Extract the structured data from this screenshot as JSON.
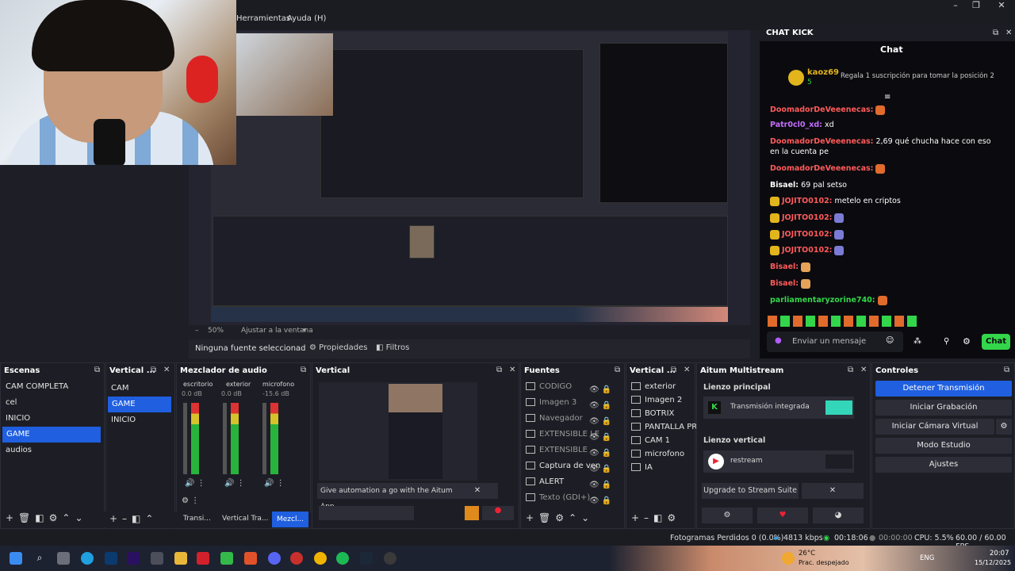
{
  "menu": {
    "tools": "Herramientas",
    "help": "Ayuda (H)"
  },
  "preview": {
    "zoom": "50%",
    "fit": "Ajustar a la ventana"
  },
  "props": {
    "no_source": "Ninguna fuente seleccionad",
    "properties": "Propiedades",
    "filters": "Filtros"
  },
  "chat": {
    "window_title": "CHAT KICK",
    "tab": "Chat",
    "pinned_user": "kaoz69",
    "pinned_count": "5",
    "pinned_text": "Regala 1 suscripción para tomar la posición 2",
    "messages": [
      {
        "user": "DoomadorDeVeeenecas:",
        "text": "",
        "color": "#ff5a5a"
      },
      {
        "user": "Patr0cl0_xd:",
        "text": " xd",
        "color": "#c56cff"
      },
      {
        "user": "DoomadorDeVeeenecas:",
        "text": " 2,69 qué chucha hace con eso en la cuenta pe",
        "color": "#ff5a5a"
      },
      {
        "user": "DoomadorDeVeeenecas:",
        "text": "",
        "color": "#ff5a5a"
      },
      {
        "user": "Bisael:",
        "text": " 69 pal setso",
        "color": "#ffffff"
      },
      {
        "user": "JOJITO0102:",
        "text": " metelo en criptos",
        "color": "#ff5a5a"
      },
      {
        "user": "JOJITO0102:",
        "text": "",
        "color": "#ff5a5a"
      },
      {
        "user": "JOJITO0102:",
        "text": "",
        "color": "#ff5a5a"
      },
      {
        "user": "JOJITO0102:",
        "text": "",
        "color": "#ff5a5a"
      },
      {
        "user": "Bisael:",
        "text": "",
        "color": "#ff5a5a"
      },
      {
        "user": "Bisael:",
        "text": "",
        "color": "#ff5a5a"
      },
      {
        "user": "parliamentaryzorine740:",
        "text": "",
        "color": "#33d64a"
      }
    ],
    "input_placeholder": "Enviar un mensaje",
    "send_label": "Chat"
  },
  "scenes": {
    "title": "Escenas",
    "items": [
      "CAM COMPLETA",
      "cel",
      "INICIO",
      "GAME",
      "audios"
    ],
    "selected": 3
  },
  "vertical_scenes": {
    "title": "Vertical ...",
    "items": [
      "CAM",
      "GAME",
      "INICIO"
    ],
    "selected": 1
  },
  "mixer": {
    "title": "Mezclador de audio",
    "channels": [
      {
        "name": "escritorio",
        "db": "0.0 dB"
      },
      {
        "name": "exterior",
        "db": "0.0 dB"
      },
      {
        "name": "microfono",
        "db": "-15.6 dB"
      }
    ],
    "scale": [
      "0",
      "-5",
      "-10",
      "-15",
      "-20",
      "-25",
      "-30",
      "-35",
      "-40",
      "-45",
      "-50",
      "-55",
      "-60"
    ],
    "tabs": [
      "Transi...",
      "Vertical Tra...",
      "Mezcl..."
    ]
  },
  "vertical_preview": {
    "title": "Vertical",
    "banner": "Give automation a go with the Aitum App"
  },
  "sources": {
    "title": "Fuentes",
    "items": [
      "CODIGO",
      "Imagen 3",
      "Navegador",
      "EXTENSIBLE LE",
      "EXTENSIBLE",
      "Captura de ven",
      "ALERT",
      "Texto (GDI+)"
    ]
  },
  "vertical_sources": {
    "title": "Vertical ...",
    "items": [
      "exterior",
      "Imagen 2",
      "BOTRIX",
      "PANTALLA PRIN",
      "CAM 1",
      "microfono",
      "IA"
    ]
  },
  "multistream": {
    "title": "Aitum Multistream",
    "main_canvas": "Lienzo principal",
    "main_output": "Transmisión integrada",
    "vertical_canvas": "Lienzo vertical",
    "vertical_output": "restream",
    "upgrade": "Upgrade to Stream Suite"
  },
  "controls": {
    "title": "Controles",
    "stop_stream": "Detener Transmisión",
    "start_recording": "Iniciar Grabación",
    "start_virtual_cam": "Iniciar Cámara Virtual",
    "studio_mode": "Modo Estudio",
    "settings": "Ajustes"
  },
  "status": {
    "dropped": "Fotogramas Perdidos 0 (0.0%)",
    "bitrate": "4813 kbps",
    "time": "00:18:06",
    "rec_time": "00:00:00",
    "cpu": "CPU: 5.5%",
    "fps": "60.00 / 60.00 FPS"
  },
  "taskbar": {
    "weather_temp": "26°C",
    "weather_text": "Prac. despejado",
    "lang": "ENG",
    "clock_time": "20:07",
    "clock_date": "15/12/2025"
  },
  "colors": {
    "accent": "#1f5fe0",
    "kick_green": "#33d64a"
  }
}
